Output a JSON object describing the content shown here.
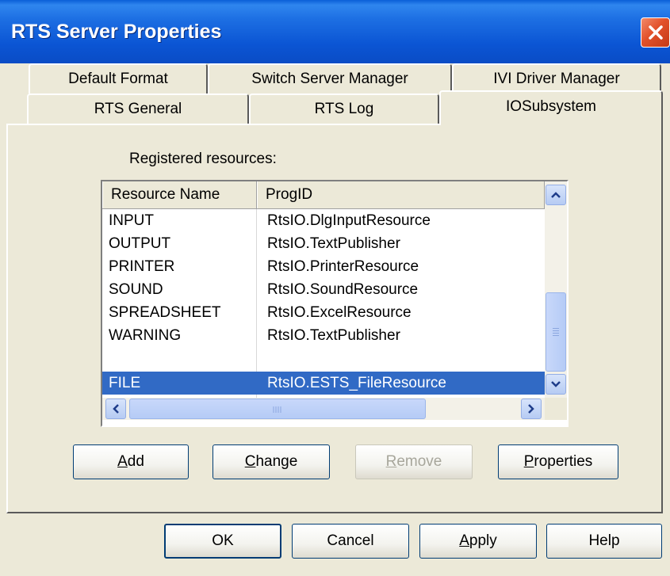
{
  "window": {
    "title": "RTS Server Properties"
  },
  "tabs_row1": [
    {
      "label": "Default Format"
    },
    {
      "label": "Switch Server Manager"
    },
    {
      "label": "IVI Driver Manager"
    }
  ],
  "tabs_row2": [
    {
      "label": "RTS General"
    },
    {
      "label": "RTS Log"
    },
    {
      "label": "IOSubsystem",
      "active": true
    }
  ],
  "resources": {
    "label": "Registered resources:",
    "columns": [
      "Resource Name",
      "ProgID"
    ],
    "rows": [
      {
        "name": "INPUT",
        "progid": "RtsIO.DlgInputResource"
      },
      {
        "name": "OUTPUT",
        "progid": "RtsIO.TextPublisher"
      },
      {
        "name": "PRINTER",
        "progid": "RtsIO.PrinterResource"
      },
      {
        "name": "SOUND",
        "progid": "RtsIO.SoundResource"
      },
      {
        "name": "SPREADSHEET",
        "progid": "RtsIO.ExcelResource"
      },
      {
        "name": "WARNING",
        "progid": "RtsIO.TextPublisher"
      },
      {
        "name": "",
        "progid": ""
      },
      {
        "name": "FILE",
        "progid": "RtsIO.ESTS_FileResource",
        "selected": true
      }
    ]
  },
  "resource_buttons": {
    "add": {
      "first": "A",
      "rest": "dd"
    },
    "change": {
      "first": "C",
      "rest": "hange"
    },
    "remove": {
      "first": "R",
      "rest": "emove"
    },
    "properties": {
      "first": "P",
      "rest": "roperties"
    }
  },
  "dialog_buttons": {
    "ok": "OK",
    "cancel": "Cancel",
    "apply": {
      "first": "A",
      "rest": "pply"
    },
    "help": "Help"
  },
  "colors": {
    "titlebar": "#0a55d4",
    "selection": "#316ac5",
    "close": "#e2512a"
  }
}
